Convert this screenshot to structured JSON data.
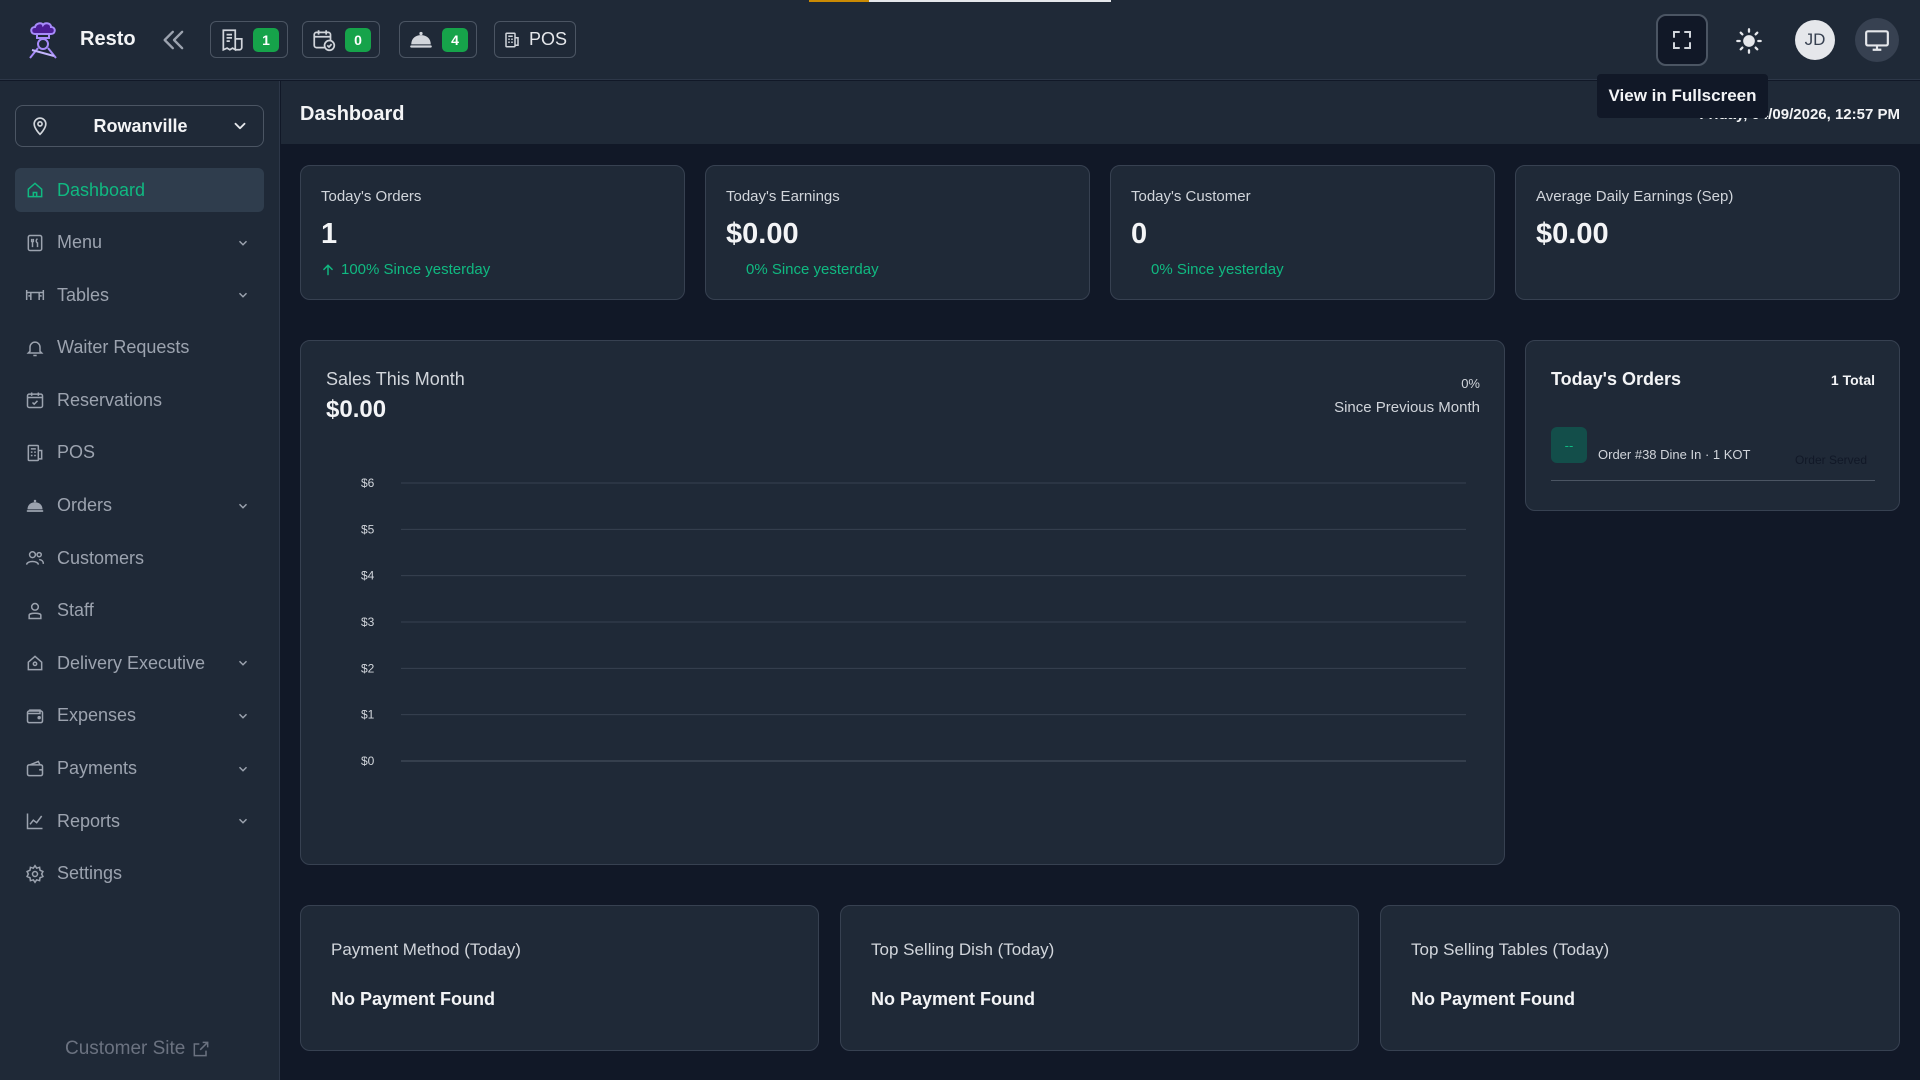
{
  "app": {
    "brand": "Resto"
  },
  "topbar": {
    "stats": [
      {
        "icon": "kot-receipt-icon",
        "count": "1"
      },
      {
        "icon": "calendar-check-icon",
        "count": "0"
      },
      {
        "icon": "food-cloche-icon",
        "count": "4"
      }
    ],
    "pos_label": "POS",
    "fullscreen_tooltip": "View in Fullscreen",
    "avatar_initials": "JD"
  },
  "sidebar": {
    "branch": "Rowanville",
    "items": [
      {
        "label": "Dashboard",
        "icon": "home-icon",
        "active": true,
        "has_children": false
      },
      {
        "label": "Menu",
        "icon": "menu-book-icon",
        "active": false,
        "has_children": true
      },
      {
        "label": "Tables",
        "icon": "table-icon",
        "active": false,
        "has_children": true
      },
      {
        "label": "Waiter Requests",
        "icon": "bell-icon",
        "active": false,
        "has_children": false
      },
      {
        "label": "Reservations",
        "icon": "calendar-check-icon",
        "active": false,
        "has_children": false
      },
      {
        "label": "POS",
        "icon": "pos-terminal-icon",
        "active": false,
        "has_children": false
      },
      {
        "label": "Orders",
        "icon": "food-cloche-icon",
        "active": false,
        "has_children": true
      },
      {
        "label": "Customers",
        "icon": "users-icon",
        "active": false,
        "has_children": false
      },
      {
        "label": "Staff",
        "icon": "user-icon",
        "active": false,
        "has_children": false
      },
      {
        "label": "Delivery Executive",
        "icon": "delivery-icon",
        "active": false,
        "has_children": true
      },
      {
        "label": "Expenses",
        "icon": "wallet-icon",
        "active": false,
        "has_children": true
      },
      {
        "label": "Payments",
        "icon": "payments-icon",
        "active": false,
        "has_children": true
      },
      {
        "label": "Reports",
        "icon": "chart-icon",
        "active": false,
        "has_children": true
      },
      {
        "label": "Settings",
        "icon": "gear-icon",
        "active": false,
        "has_children": false
      }
    ],
    "customer_site": "Customer Site"
  },
  "header": {
    "title": "Dashboard",
    "datetime": "Friday, 04/09/2026, 12:57 PM"
  },
  "stats": [
    {
      "label": "Today's Orders",
      "value": "1",
      "delta": "100% Since yesterday",
      "trend": "up"
    },
    {
      "label": "Today's Earnings",
      "value": "$0.00",
      "delta": "0% Since yesterday",
      "trend": "none"
    },
    {
      "label": "Today's Customer",
      "value": "0",
      "delta": "0% Since yesterday",
      "trend": "none"
    },
    {
      "label": "Average Daily Earnings (Sep)",
      "value": "$0.00",
      "delta": "",
      "trend": "none"
    }
  ],
  "sales": {
    "title": "Sales This Month",
    "amount": "$0.00",
    "change": "0%",
    "since": "Since Previous Month"
  },
  "chart_data": {
    "type": "line",
    "title": "Sales This Month",
    "xlabel": "",
    "ylabel": "",
    "y_ticks": [
      "$6",
      "$5",
      "$4",
      "$3",
      "$2",
      "$1",
      "$0"
    ],
    "ylim": [
      0,
      6
    ],
    "grid": true,
    "series": [
      {
        "values": [
          0
        ]
      }
    ]
  },
  "todays_orders": {
    "title": "Today's Orders",
    "total": "1 Total",
    "orders": [
      {
        "thumb": "--",
        "text": "Order #38 Dine In · 1 KOT",
        "status": "Order Served"
      }
    ]
  },
  "bottom_cards": [
    {
      "title": "Payment Method (Today)",
      "message": "No Payment Found"
    },
    {
      "title": "Top Selling Dish (Today)",
      "message": "No Payment Found"
    },
    {
      "title": "Top Selling Tables (Today)",
      "message": "No Payment Found"
    }
  ],
  "colors": {
    "accent": "#10b981",
    "badge": "#16a34a",
    "panel": "#1f2937",
    "background": "#111827"
  }
}
